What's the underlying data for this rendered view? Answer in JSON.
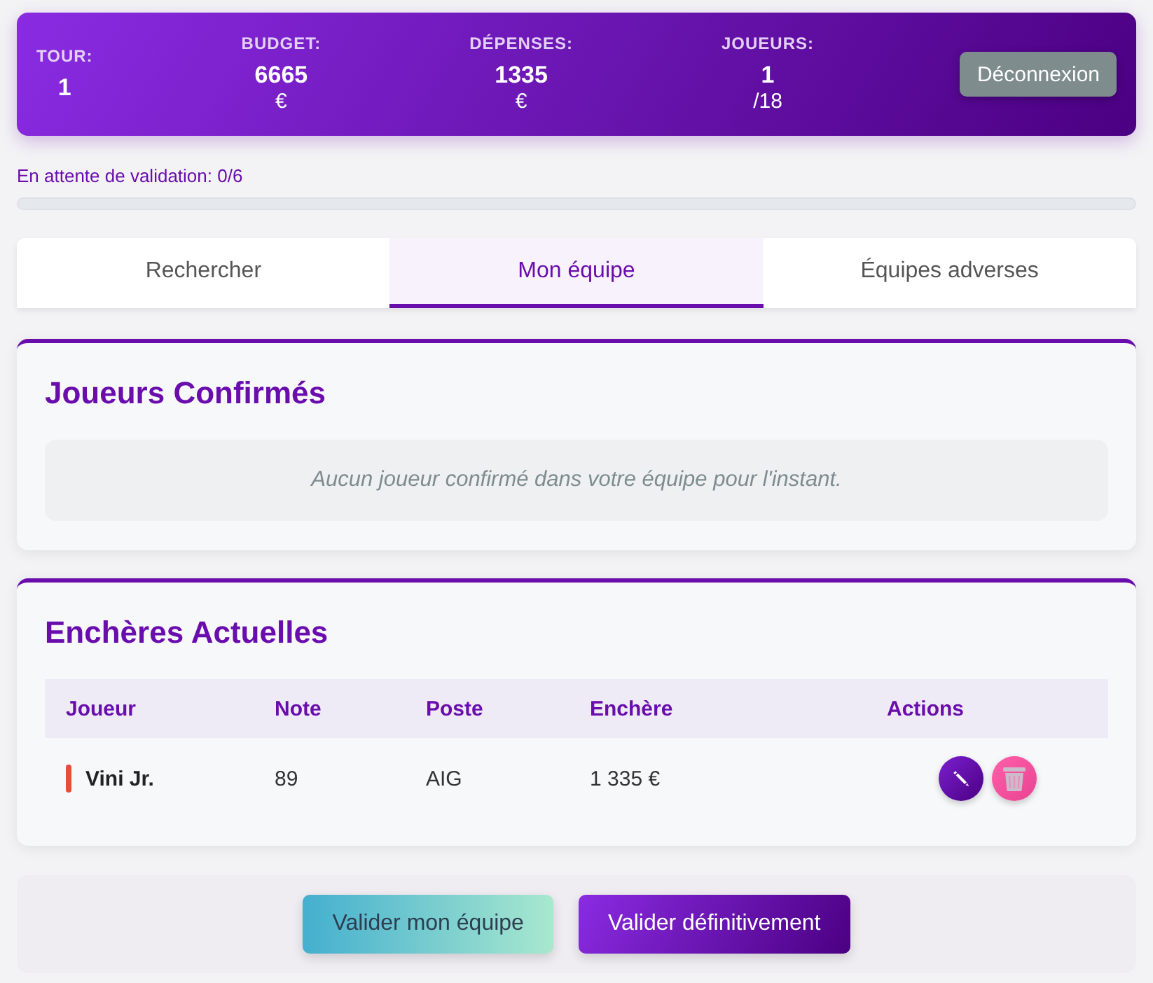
{
  "header": {
    "stats": [
      {
        "label": "TOUR:",
        "value": "1"
      },
      {
        "label": "BUDGET:",
        "value": "6665",
        "unit": "€"
      },
      {
        "label": "DÉPENSES:",
        "value": "1335",
        "unit": "€"
      },
      {
        "label": "JOUEURS:",
        "value": "1",
        "unit": "/18"
      }
    ],
    "logout_button": "Déconnexion"
  },
  "validation": {
    "label": "En attente de validation: 0/6",
    "level": 0
  },
  "tabs": [
    {
      "label": "Rechercher",
      "selected": false
    },
    {
      "label": "Mon équipe",
      "selected": true
    },
    {
      "label": "Équipes adverses",
      "selected": false
    }
  ],
  "confirmed": {
    "title": "Joueurs Confirmés",
    "empty_message": "Aucun joueur confirmé dans votre équipe pour l'instant."
  },
  "auctions": {
    "title": "Enchères Actuelles",
    "columns": [
      "Joueur",
      "Note",
      "Poste",
      "Enchère",
      "Actions"
    ],
    "rows": [
      {
        "player": "Vini Jr.",
        "color": "#e74c3c",
        "rating": "89",
        "position": "AIG",
        "bid": "1 335 €"
      }
    ]
  },
  "footer_buttons": [
    {
      "label": "Valider mon équipe",
      "kind": "secondary"
    },
    {
      "label": "Valider définitivement",
      "kind": "primary"
    }
  ]
}
